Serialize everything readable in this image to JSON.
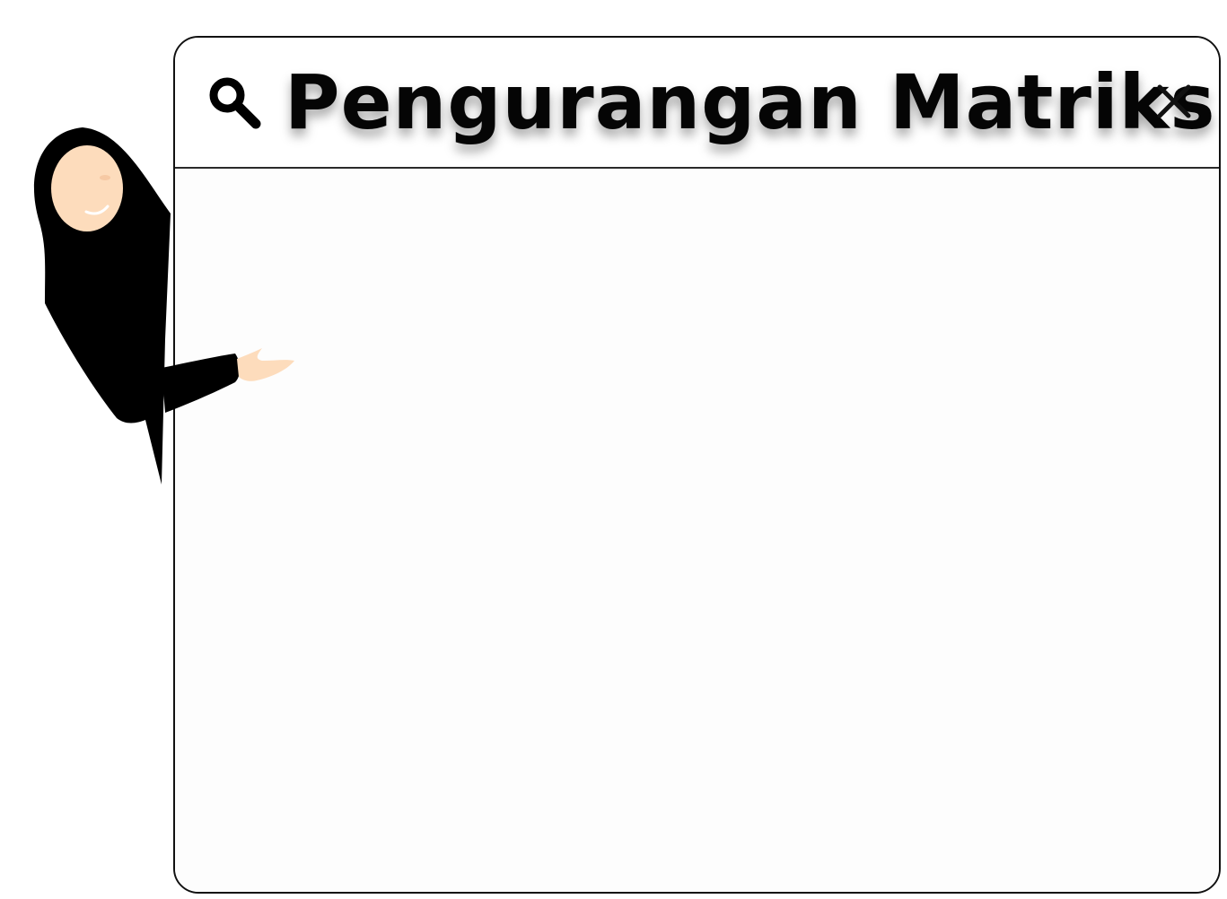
{
  "window": {
    "title": "Pengurangan Matriks"
  },
  "icons": {
    "search": "search-icon",
    "close": "close-icon"
  },
  "colors": {
    "outline": "#111111",
    "background": "#ffffff",
    "hijab": "#000000",
    "skin": "#fddcbc"
  }
}
